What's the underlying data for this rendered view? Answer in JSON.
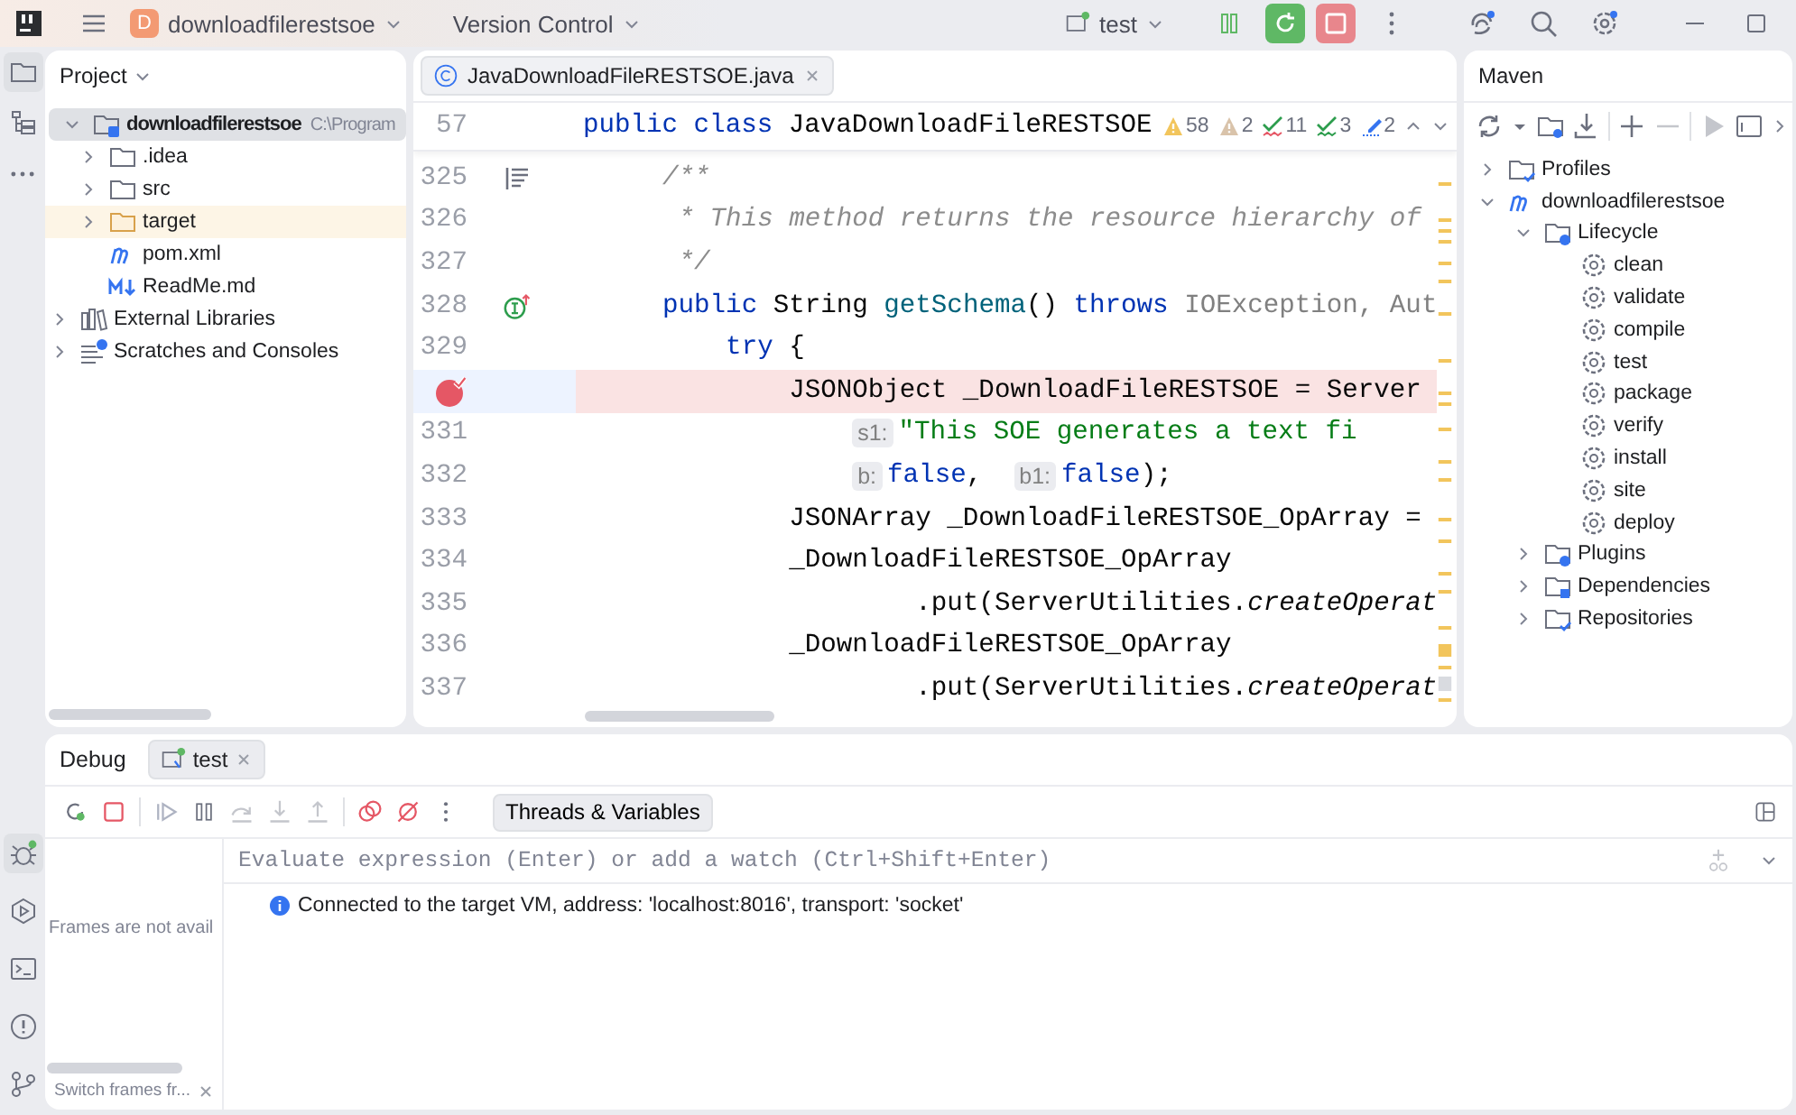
{
  "topbar": {
    "project_badge": "D",
    "project": "downloadfilerestsoe",
    "vcs": "Version Control",
    "run_config": "test"
  },
  "tool_strip": {
    "top": [
      {
        "kind": "project",
        "selected": true
      },
      {
        "kind": "structure",
        "selected": false
      },
      {
        "kind": "more",
        "selected": false
      }
    ],
    "bottom": [
      {
        "kind": "debug",
        "selected": true
      },
      {
        "kind": "run",
        "selected": false
      },
      {
        "kind": "terminal",
        "selected": false
      },
      {
        "kind": "problems",
        "selected": false
      },
      {
        "kind": "git",
        "selected": false
      }
    ]
  },
  "project_panel": {
    "title": "Project",
    "tree": [
      {
        "label": "downloadfilerestsoe",
        "detail": "C:\\Program",
        "kind": "module",
        "expanded": true,
        "selected": true,
        "hovered": false,
        "children": [
          {
            "label": ".idea",
            "kind": "folder",
            "expanded": false,
            "selected": false,
            "hovered": false
          },
          {
            "label": "src",
            "kind": "folder",
            "expanded": false,
            "selected": false,
            "hovered": false
          },
          {
            "label": "target",
            "kind": "excluded-folder",
            "expanded": false,
            "selected": false,
            "hovered": true
          },
          {
            "label": "pom.xml",
            "kind": "maven",
            "selected": false,
            "hovered": false
          },
          {
            "label": "ReadMe.md",
            "kind": "markdown",
            "selected": false,
            "hovered": false
          }
        ]
      },
      {
        "label": "External Libraries",
        "kind": "library",
        "expanded": false,
        "selected": false,
        "hovered": false
      },
      {
        "label": "Scratches and Consoles",
        "kind": "scratch",
        "expanded": false,
        "selected": false,
        "hovered": false
      }
    ]
  },
  "editor": {
    "tab": {
      "label": "JavaDownloadFileRESTSOE.java",
      "selected": true
    },
    "sticky": {
      "number": "57",
      "tokens": [
        {
          "kind": "kw",
          "text": "public class "
        },
        {
          "kind": "plain",
          "text": "JavaDownloadFileRESTSOE"
        }
      ]
    },
    "inspections": [
      {
        "kind": "warning",
        "count": "58"
      },
      {
        "kind": "weak-warning",
        "count": "2"
      },
      {
        "kind": "typo",
        "count": "11"
      },
      {
        "kind": "grammar",
        "count": "3"
      },
      {
        "kind": "spelling",
        "count": "2"
      }
    ],
    "lines": [
      {
        "number": "325",
        "kind": "doc",
        "breakpoint": false,
        "highlighted": false,
        "tokens": [
          {
            "kind": "comment",
            "text": "    /**"
          }
        ]
      },
      {
        "number": "326",
        "kind": "plain",
        "breakpoint": false,
        "highlighted": false,
        "tokens": [
          {
            "kind": "comment",
            "text": "     * This method returns the resource hierarchy of"
          }
        ]
      },
      {
        "number": "327",
        "kind": "plain",
        "breakpoint": false,
        "highlighted": false,
        "tokens": [
          {
            "kind": "comment",
            "text": "     */"
          }
        ]
      },
      {
        "number": "328",
        "kind": "implements",
        "breakpoint": false,
        "highlighted": false,
        "tokens": [
          {
            "kind": "kw",
            "text": "    public "
          },
          {
            "kind": "plain",
            "text": "String "
          },
          {
            "kind": "fn",
            "text": "getSchema"
          },
          {
            "kind": "plain",
            "text": "() "
          },
          {
            "kind": "kw",
            "text": "throws "
          },
          {
            "kind": "muted",
            "text": "IOException, Aut"
          }
        ]
      },
      {
        "number": "329",
        "kind": "plain",
        "breakpoint": false,
        "highlighted": false,
        "tokens": [
          {
            "kind": "kw",
            "text": "        try "
          },
          {
            "kind": "plain",
            "text": "{"
          }
        ]
      },
      {
        "kind": "plain",
        "breakpoint": true,
        "highlighted": true,
        "tokens": [
          {
            "kind": "plain",
            "text": "            JSONObject _DownloadFileRESTSOE = Server"
          }
        ]
      },
      {
        "number": "331",
        "kind": "hints",
        "breakpoint": false,
        "highlighted": false,
        "tokens": [
          {
            "kind": "hint",
            "text": "s1:"
          },
          {
            "kind": "str",
            "text": "\"This SOE generates a text fi"
          }
        ]
      },
      {
        "number": "332",
        "kind": "hints",
        "breakpoint": false,
        "highlighted": false,
        "tokens": [
          {
            "kind": "hint",
            "text": "b:"
          },
          {
            "kind": "kw",
            "text": "false"
          },
          {
            "kind": "plain",
            "text": ",  "
          },
          {
            "kind": "hint",
            "text": "b1:"
          },
          {
            "kind": "kw",
            "text": "false"
          },
          {
            "kind": "plain",
            "text": ");"
          }
        ]
      },
      {
        "number": "333",
        "kind": "plain",
        "breakpoint": false,
        "highlighted": false,
        "tokens": [
          {
            "kind": "plain",
            "text": "            JSONArray _DownloadFileRESTSOE_OpArray ="
          }
        ]
      },
      {
        "number": "334",
        "kind": "plain",
        "breakpoint": false,
        "highlighted": false,
        "tokens": [
          {
            "kind": "plain",
            "text": "            _DownloadFileRESTSOE_OpArray"
          }
        ]
      },
      {
        "number": "335",
        "kind": "plain",
        "breakpoint": false,
        "highlighted": false,
        "tokens": [
          {
            "kind": "plain",
            "text": "                    .put(ServerUtilities."
          },
          {
            "kind": "italic",
            "text": "createOperat"
          }
        ]
      },
      {
        "number": "336",
        "kind": "plain",
        "breakpoint": false,
        "highlighted": false,
        "tokens": [
          {
            "kind": "plain",
            "text": "            _DownloadFileRESTSOE_OpArray"
          }
        ]
      },
      {
        "number": "337",
        "kind": "plain",
        "breakpoint": false,
        "highlighted": false,
        "tokens": [
          {
            "kind": "plain",
            "text": "                    .put(ServerUtilities."
          },
          {
            "kind": "italic",
            "text": "createOperat"
          }
        ]
      }
    ]
  },
  "maven": {
    "title": "Maven",
    "tree": [
      {
        "label": "Profiles",
        "kind": "check-folder",
        "expanded": false
      },
      {
        "label": "downloadfilerestsoe",
        "kind": "maven",
        "expanded": true,
        "children": [
          {
            "label": "Lifecycle",
            "kind": "gear-folder",
            "expanded": true,
            "children": [
              {
                "label": "clean",
                "kind": "gear"
              },
              {
                "label": "validate",
                "kind": "gear"
              },
              {
                "label": "compile",
                "kind": "gear"
              },
              {
                "label": "test",
                "kind": "gear"
              },
              {
                "label": "package",
                "kind": "gear"
              },
              {
                "label": "verify",
                "kind": "gear"
              },
              {
                "label": "install",
                "kind": "gear"
              },
              {
                "label": "site",
                "kind": "gear"
              },
              {
                "label": "deploy",
                "kind": "gear"
              }
            ]
          },
          {
            "label": "Plugins",
            "kind": "gear-folder",
            "expanded": false
          },
          {
            "label": "Dependencies",
            "kind": "box-folder",
            "expanded": false
          },
          {
            "label": "Repositories",
            "kind": "check-folder",
            "expanded": false
          }
        ]
      }
    ]
  },
  "debug": {
    "title": "Debug",
    "tabs": [
      {
        "label": "test",
        "selected": true
      }
    ],
    "view_button": "Threads & Variables",
    "frames_message": "Frames are not avail",
    "frames_hint": "Switch frames fr...",
    "evaluate": {
      "placeholder": "Evaluate expression (Enter) or add a watch (Ctrl+Shift+Enter)"
    },
    "console": [
      {
        "kind": "info",
        "text": "Connected to the target VM, address: 'localhost:8016', transport: 'socket'"
      }
    ]
  }
}
